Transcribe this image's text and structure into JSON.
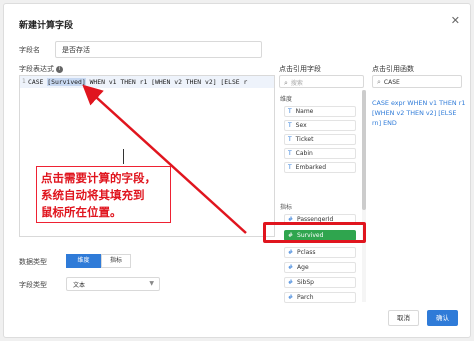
{
  "dialog": {
    "title": "新建计算字段",
    "close_icon": "close-icon"
  },
  "form": {
    "name_label": "字段名",
    "name_value": "是否存活",
    "expr_label": "字段表达式",
    "line_number": "1",
    "expr_text": "CASE [Survived] WHEN v1 THEN r1 [WHEN v2 THEN v2] [ELSE r",
    "expr_highlight": "[Survived]",
    "expr_before": "CASE ",
    "expr_after": " WHEN v1 THEN r1 [WHEN v2 THEN v2] [ELSE r",
    "data_type_label": "数据类型",
    "data_type_options": [
      "维度",
      "指标"
    ],
    "field_type_label": "字段类型",
    "field_type_value": "文本"
  },
  "annotation": {
    "lines": [
      "点击需要计算的字段，",
      "系统自动将其填充到",
      "鼠标所在位置。"
    ],
    "color": "#e0151e"
  },
  "fields_column": {
    "title": "点击引用字段",
    "search_placeholder": "搜索",
    "dimension_group": "维度",
    "dimension_fields": [
      "Name",
      "Sex",
      "Ticket",
      "Cabin",
      "Embarked"
    ],
    "metric_group": "指标",
    "metric_fields": [
      "PassengerId",
      "Survived",
      "Pclass",
      "Age",
      "SibSp",
      "Parch"
    ],
    "highlighted_field": "Survived",
    "highlight_color": "#2fa54e"
  },
  "functions_column": {
    "title": "点击引用函数",
    "search_value": "CASE",
    "function_syntax": "CASE expr WHEN v1 THEN r1 [WHEN v2 THEN v2] [ELSE rn] END"
  },
  "buttons": {
    "cancel": "取消",
    "ok": "确认"
  },
  "colors": {
    "accent": "#2f7bd8",
    "annotation_red": "#e0151e"
  }
}
